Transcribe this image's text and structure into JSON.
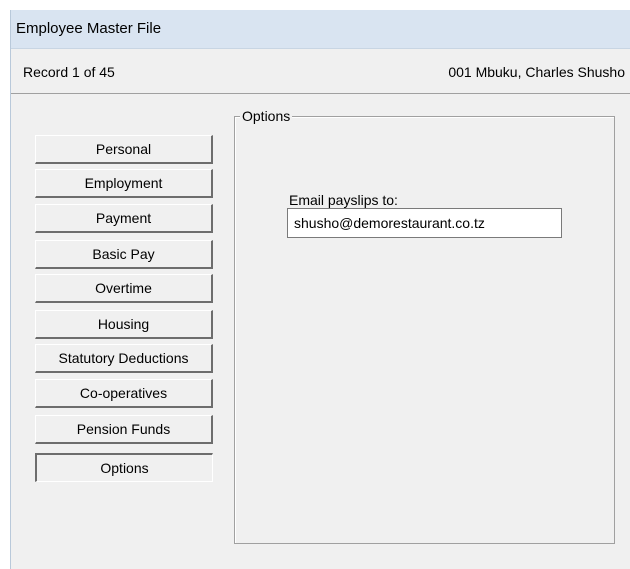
{
  "window": {
    "title": "Employee Master File"
  },
  "record_bar": {
    "record_position": "Record 1 of 45",
    "employee": "001  Mbuku, Charles Shusho"
  },
  "nav": {
    "items": [
      {
        "label": "Personal",
        "active": false
      },
      {
        "label": "Employment",
        "active": false
      },
      {
        "label": "Payment",
        "active": false
      },
      {
        "label": "Basic Pay",
        "active": false
      },
      {
        "label": "Overtime",
        "active": false
      },
      {
        "label": "Housing",
        "active": false
      },
      {
        "label": "Statutory Deductions",
        "active": false
      },
      {
        "label": "Co-operatives",
        "active": false
      },
      {
        "label": "Pension Funds",
        "active": false
      },
      {
        "label": "Options",
        "active": true
      }
    ]
  },
  "options_panel": {
    "group_title": "Options",
    "email_label": "Email payslips to:",
    "email_value": "shusho@demorestaurant.co.tz"
  },
  "colors": {
    "titlebar_bg": "#d9e4f1",
    "window_bg": "#f0f0f0"
  }
}
